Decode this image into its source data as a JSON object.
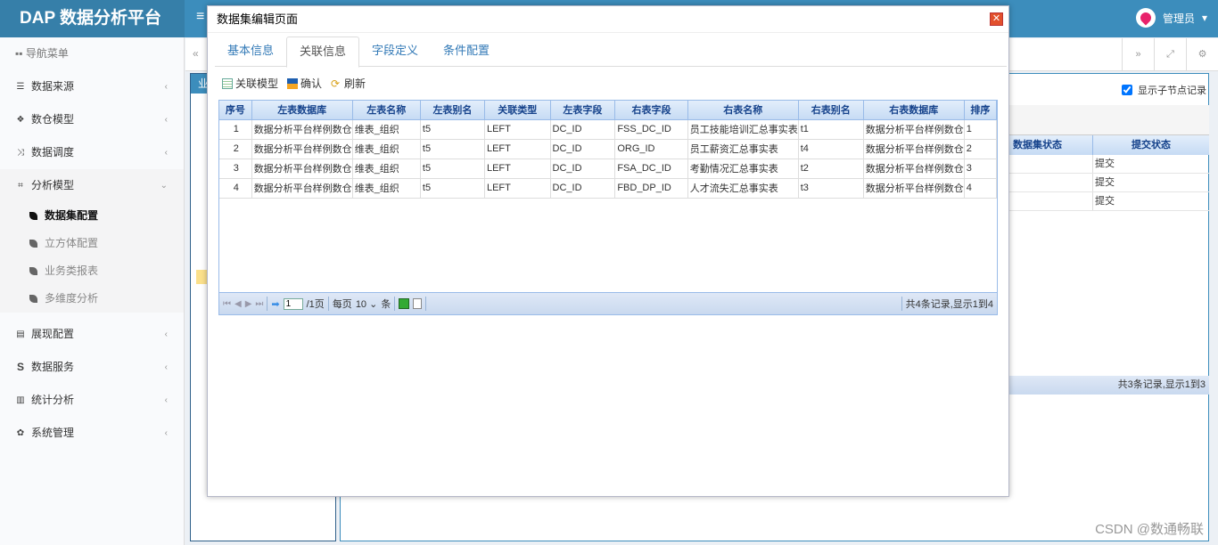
{
  "app": {
    "title": "DAP 数据分析平台",
    "user": "管理员"
  },
  "sidebar": {
    "header": "导航菜单",
    "items": [
      {
        "label": "数据来源",
        "icon": "database-icon"
      },
      {
        "label": "数仓模型",
        "icon": "cubes-icon"
      },
      {
        "label": "数据调度",
        "icon": "shuffle-icon"
      },
      {
        "label": "分析模型",
        "icon": "object-group-icon",
        "expanded": true,
        "children": [
          "数据集配置",
          "立方体配置",
          "业务类报表",
          "多维度分析"
        ],
        "active_child": "数据集配置"
      },
      {
        "label": "展现配置",
        "icon": "film-icon"
      },
      {
        "label": "数据服务",
        "icon": "dollar-s-icon"
      },
      {
        "label": "统计分析",
        "icon": "bar-chart-icon"
      },
      {
        "label": "系统管理",
        "icon": "gear-icon"
      }
    ]
  },
  "background": {
    "left_panel_header": "业",
    "show_children_label": "显示子节点记录",
    "show_children_checked": true,
    "columns": [
      "数据集状态",
      "提交状态"
    ],
    "rows": [
      [
        "",
        "提交"
      ],
      [
        "",
        "提交"
      ],
      [
        "",
        "提交"
      ]
    ],
    "pager_info": "共3条记录,显示1到3"
  },
  "modal": {
    "title": "数据集编辑页面",
    "tabs": [
      "基本信息",
      "关联信息",
      "字段定义",
      "条件配置"
    ],
    "active_tab": "关联信息",
    "toolbar": [
      "关联模型",
      "确认",
      "刷新"
    ],
    "columns": [
      "序号",
      "左表数据库",
      "左表名称",
      "左表别名",
      "关联类型",
      "左表字段",
      "右表字段",
      "右表名称",
      "右表别名",
      "右表数据库",
      "排序"
    ],
    "rows": [
      [
        "1",
        "数据分析平台样例数仓",
        "维表_组织",
        "t5",
        "LEFT",
        "DC_ID",
        "FSS_DC_ID",
        "员工技能培训汇总事实表",
        "t1",
        "数据分析平台样例数仓",
        "1"
      ],
      [
        "2",
        "数据分析平台样例数仓",
        "维表_组织",
        "t5",
        "LEFT",
        "DC_ID",
        "ORG_ID",
        "员工薪资汇总事实表",
        "t4",
        "数据分析平台样例数仓",
        "2"
      ],
      [
        "3",
        "数据分析平台样例数仓",
        "维表_组织",
        "t5",
        "LEFT",
        "DC_ID",
        "FSA_DC_ID",
        "考勤情况汇总事实表",
        "t2",
        "数据分析平台样例数仓",
        "3"
      ],
      [
        "4",
        "数据分析平台样例数仓",
        "维表_组织",
        "t5",
        "LEFT",
        "DC_ID",
        "FBD_DP_ID",
        "人才流失汇总事实表",
        "t3",
        "数据分析平台样例数仓",
        "4"
      ]
    ],
    "pager": {
      "page": "1",
      "total_pages": "/1页",
      "per_page_label": "每页",
      "per_page": "10",
      "unit": "条",
      "info": "共4条记录,显示1到4"
    }
  },
  "watermark": "CSDN @数通畅联"
}
